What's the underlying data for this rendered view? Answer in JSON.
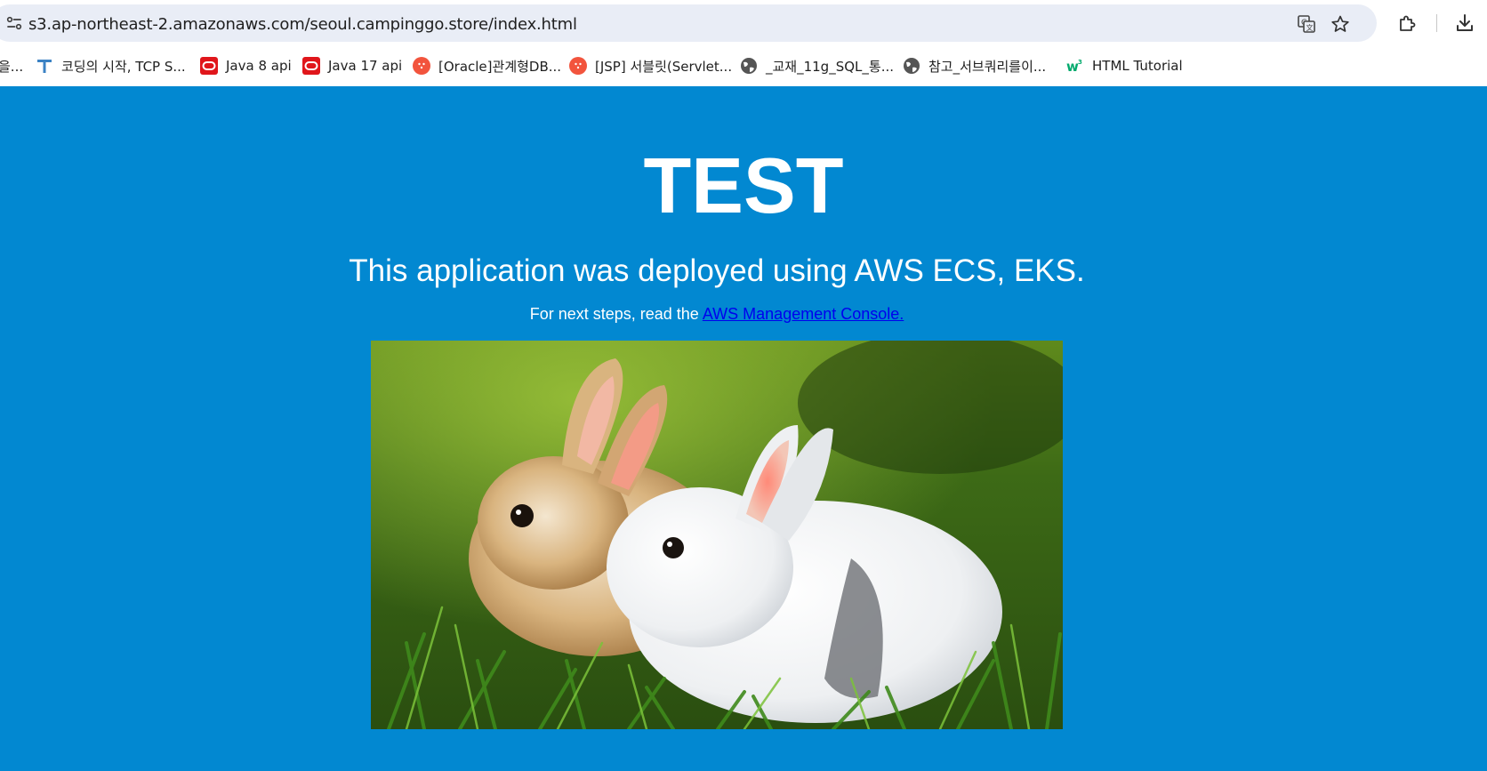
{
  "browser": {
    "url": "s3.ap-northeast-2.amazonaws.com/seoul.campinggo.store/index.html"
  },
  "bookmarks": [
    {
      "label": "을...",
      "icon": "truncated-bookmark"
    },
    {
      "label": "코딩의 시작, TCP S...",
      "icon": "tcp-school-t-icon"
    },
    {
      "label": "Java 8 api",
      "icon": "oracle-icon"
    },
    {
      "label": "Java 17 api",
      "icon": "oracle-icon"
    },
    {
      "label": "[Oracle]관계형DB...",
      "icon": "red-circle-icon"
    },
    {
      "label": "[JSP] 서블릿(Servlet...",
      "icon": "red-circle-icon"
    },
    {
      "label": "_교재_11g_SQL_통...",
      "icon": "globe-icon"
    },
    {
      "label": "참고_서브쿼리를이...",
      "icon": "globe-icon"
    },
    {
      "label": "HTML Tutorial",
      "icon": "w3schools-icon"
    }
  ],
  "page": {
    "title": "TEST",
    "subtitle": "This application was deployed using AWS ECS, EKS.",
    "steps_prefix": "For next steps, read the ",
    "steps_link": "AWS Management Console.",
    "image_subject": "two-rabbits-in-grass-photo"
  },
  "colors": {
    "page_background": "#0288d1",
    "text": "#ffffff",
    "link": "#0000ee",
    "omnibox": "#e9edf6"
  }
}
